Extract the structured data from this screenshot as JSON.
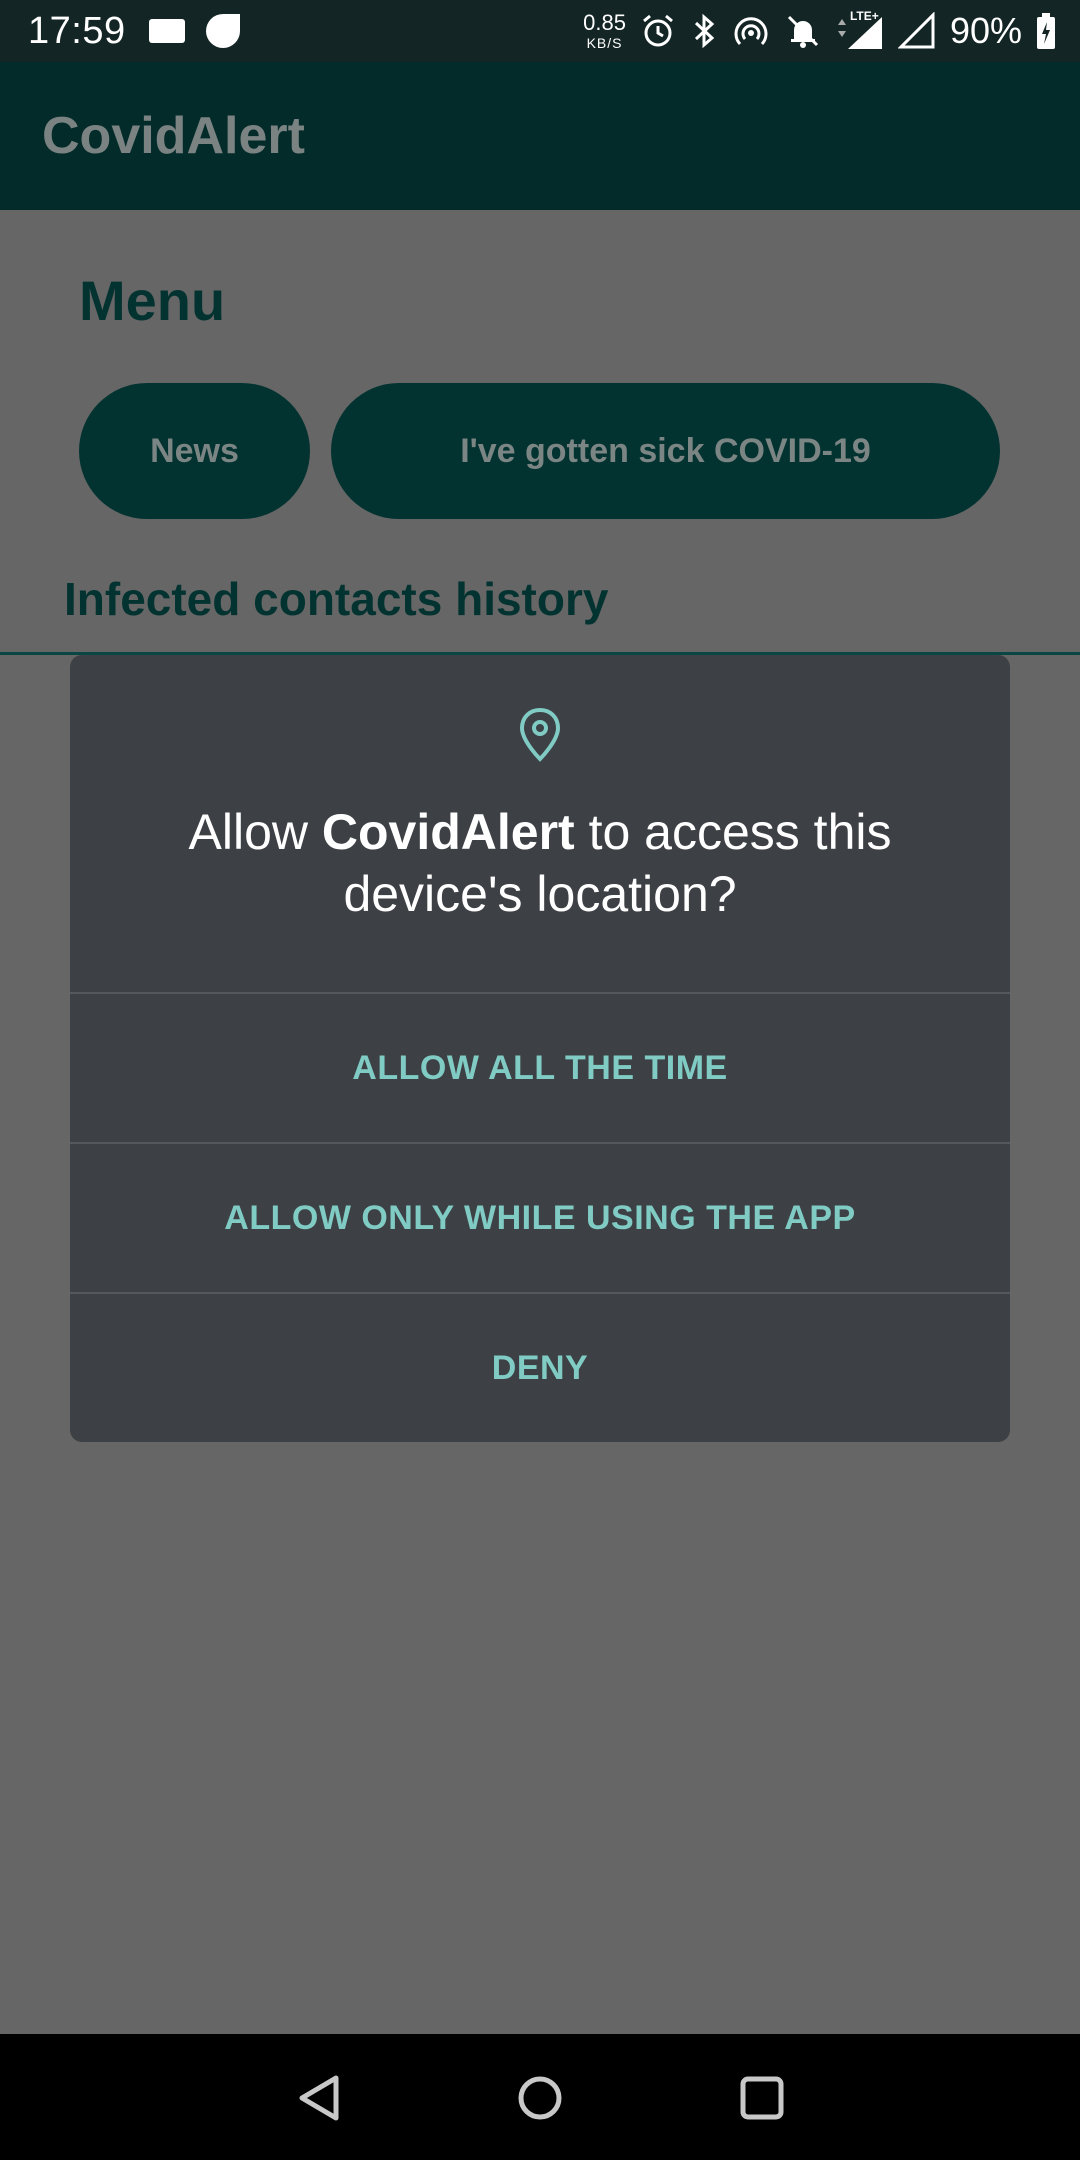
{
  "status_bar": {
    "time": "17:59",
    "net_speed_value": "0.85",
    "net_speed_unit": "KB/S",
    "battery": "90%",
    "icons": [
      "message-icon",
      "notification-blob-icon",
      "alarm-icon",
      "bluetooth-icon",
      "hotspot-icon",
      "do-not-disturb-icon",
      "lte-signal-icon",
      "wifi-signal-icon",
      "battery-charging-icon"
    ],
    "lte_label": "LTE+"
  },
  "app_bar": {
    "title": "CovidAlert"
  },
  "menu": {
    "heading": "Menu",
    "buttons": [
      "News",
      "I've gotten sick COVID-19"
    ]
  },
  "history": {
    "title": "Infected contacts history"
  },
  "dialog": {
    "icon": "location-pin-icon",
    "message_prefix": "Allow ",
    "message_app": "CovidAlert",
    "message_suffix": " to access this device's location?",
    "buttons": [
      "ALLOW ALL THE TIME",
      "ALLOW ONLY WHILE USING THE APP",
      "DENY"
    ]
  },
  "nav_bar": {
    "icons": [
      "back-icon",
      "home-icon",
      "recents-icon"
    ]
  },
  "colors": {
    "status_bar": "#132524",
    "app_bar": "#032b2a",
    "dialog_bg": "#3d4044",
    "dialog_button_text": "#80cbc4",
    "scrim_bg": "#666666"
  }
}
